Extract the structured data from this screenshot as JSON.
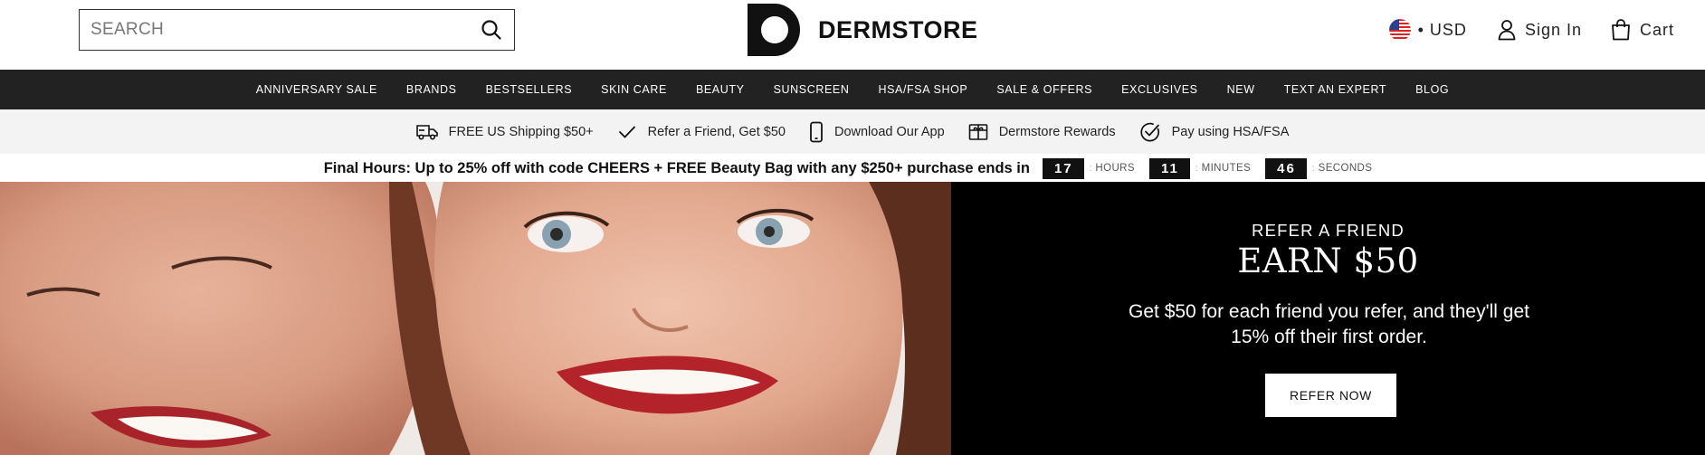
{
  "search": {
    "placeholder": "SEARCH"
  },
  "logo": {
    "wordmark": "DERMSTORE"
  },
  "header": {
    "currency": "• USD",
    "sign_in": "Sign In",
    "cart": "Cart"
  },
  "nav": {
    "items": [
      {
        "label": "ANNIVERSARY SALE"
      },
      {
        "label": "BRANDS"
      },
      {
        "label": "BESTSELLERS"
      },
      {
        "label": "SKIN CARE"
      },
      {
        "label": "BEAUTY"
      },
      {
        "label": "SUNSCREEN"
      },
      {
        "label": "HSA/FSA SHOP"
      },
      {
        "label": "SALE & OFFERS"
      },
      {
        "label": "EXCLUSIVES"
      },
      {
        "label": "NEW"
      },
      {
        "label": "TEXT AN EXPERT"
      },
      {
        "label": "BLOG"
      }
    ]
  },
  "benefits": {
    "items": [
      {
        "label": "FREE US Shipping $50+",
        "icon": "truck-icon"
      },
      {
        "label": "Refer a Friend, Get $50",
        "icon": "checkmark-icon"
      },
      {
        "label": "Download Our App",
        "icon": "phone-icon"
      },
      {
        "label": "Dermstore Rewards",
        "icon": "gift-icon"
      },
      {
        "label": "Pay using HSA/FSA",
        "icon": "check-circle-icon"
      }
    ]
  },
  "promo": {
    "message": "Final Hours: Up to 25% off with code CHEERS + FREE Beauty Bag with any $250+ purchase ends in",
    "hours": "17",
    "hours_label": "HOURS",
    "minutes": "11",
    "minutes_label": "MINUTES",
    "seconds": "46",
    "seconds_label": "SECONDS",
    "separator": ":"
  },
  "hero": {
    "eyebrow": "REFER A FRIEND",
    "headline": "EARN $50",
    "body": "Get $50 for each friend you refer, and they'll get 15% off their first order.",
    "cta": "REFER NOW"
  },
  "colors": {
    "nav_bg": "#222222",
    "benefits_bg": "#f3f3f3",
    "hero_panel_bg": "#000000",
    "countdown_bg": "#111111"
  }
}
